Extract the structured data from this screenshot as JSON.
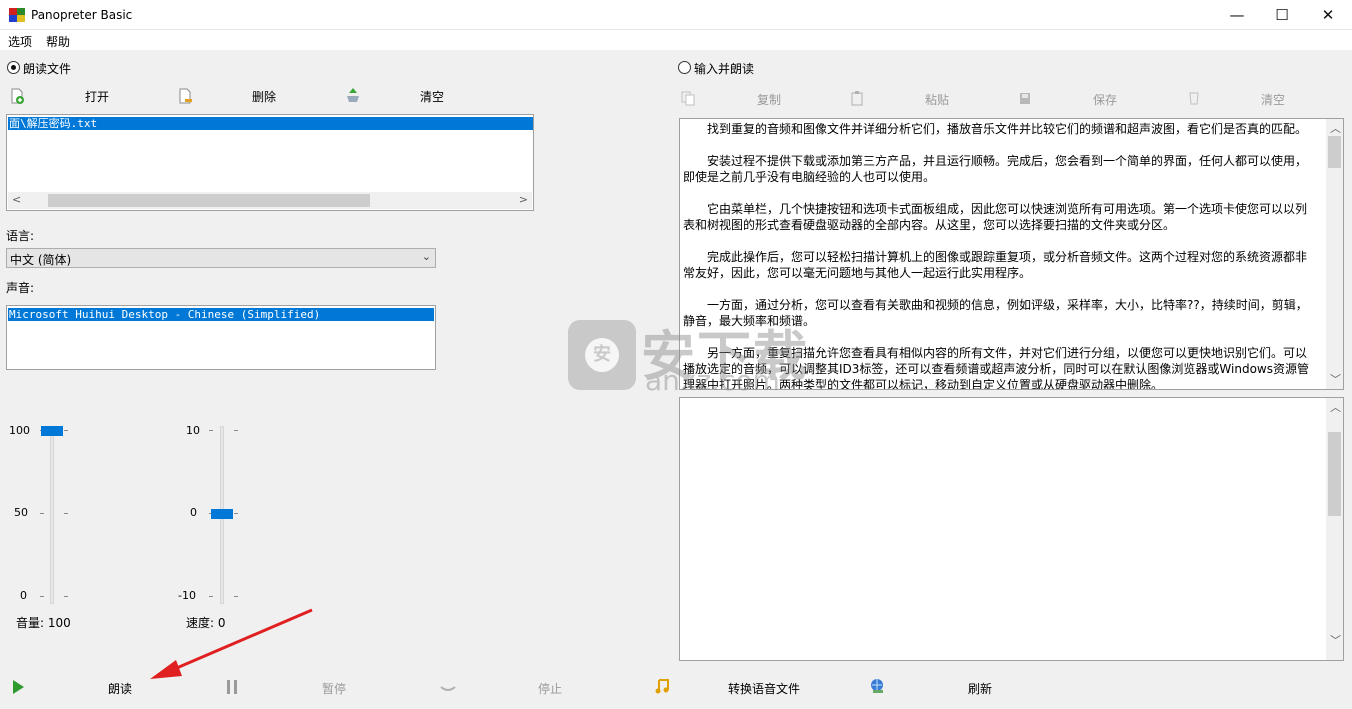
{
  "window": {
    "title": "Panopreter Basic",
    "min": "—",
    "max": "☐",
    "close": "✕"
  },
  "menu": {
    "items": [
      "选项",
      "帮助"
    ]
  },
  "left": {
    "mode_label": "朗读文件",
    "toolbar": {
      "open": "打开",
      "delete": "删除",
      "clear": "清空"
    },
    "files": [
      "面\\解压密码.txt"
    ],
    "language_label": "语言:",
    "language_value": "中文 (简体)",
    "voice_label": "声音:",
    "voices": [
      "Microsoft Huihui Desktop - Chinese (Simplified)"
    ],
    "volume": {
      "max": "100",
      "mid": "50",
      "min": "0",
      "label": "音量: 100",
      "value": 100
    },
    "speed": {
      "max": "10",
      "mid": "0",
      "min": "-10",
      "label": "速度: 0",
      "value": 0
    }
  },
  "right": {
    "mode_label": "输入并朗读",
    "toolbar": {
      "copy": "复制",
      "paste": "粘贴",
      "save": "保存",
      "clear": "清空"
    },
    "paragraphs": [
      "找到重复的音频和图像文件并详细分析它们，播放音乐文件并比较它们的频谱和超声波图，看它们是否真的匹配。",
      "安装过程不提供下载或添加第三方产品，并且运行顺畅。完成后，您会看到一个简单的界面，任何人都可以使用，即使是之前几乎没有电脑经验的人也可以使用。",
      "它由菜单栏，几个快捷按钮和选项卡式面板组成，因此您可以快速浏览所有可用选项。第一个选项卡使您可以以列表和树视图的形式查看硬盘驱动器的全部内容。从这里，您可以选择要扫描的文件夹或分区。",
      "完成此操作后，您可以轻松扫描计算机上的图像或跟踪重复项，或分析音频文件。这两个过程对您的系统资源都非常友好，因此，您可以毫无问题地与其他人一起运行此实用程序。",
      "一方面，通过分析，您可以查看有关歌曲和视频的信息，例如评级，采样率，大小，比特率??，持续时间，剪辑，静音，最大频率和频谱。",
      "另一方面，重复扫描允许您查看具有相似内容的所有文件，并对它们进行分组，以便您可以更快地识别它们。可以播放选定的音频，可以调整其ID3标签，还可以查看频谱或超声波分析，同时可以在默认图像浏览器或Windows资源管理器中打开照片。两种类型的文件都可以标记，移动到自定义位置或从硬盘驱动器中删除。"
    ]
  },
  "bottom": {
    "read": "朗读",
    "pause": "暂停",
    "stop": "停止",
    "convert": "转换语音文件",
    "refresh": "刷新"
  },
  "watermark": {
    "text": "安下载",
    "sub": "anxz.com"
  },
  "colors": {
    "accent": "#0078d7",
    "annotation_arrow": "#e02020"
  }
}
